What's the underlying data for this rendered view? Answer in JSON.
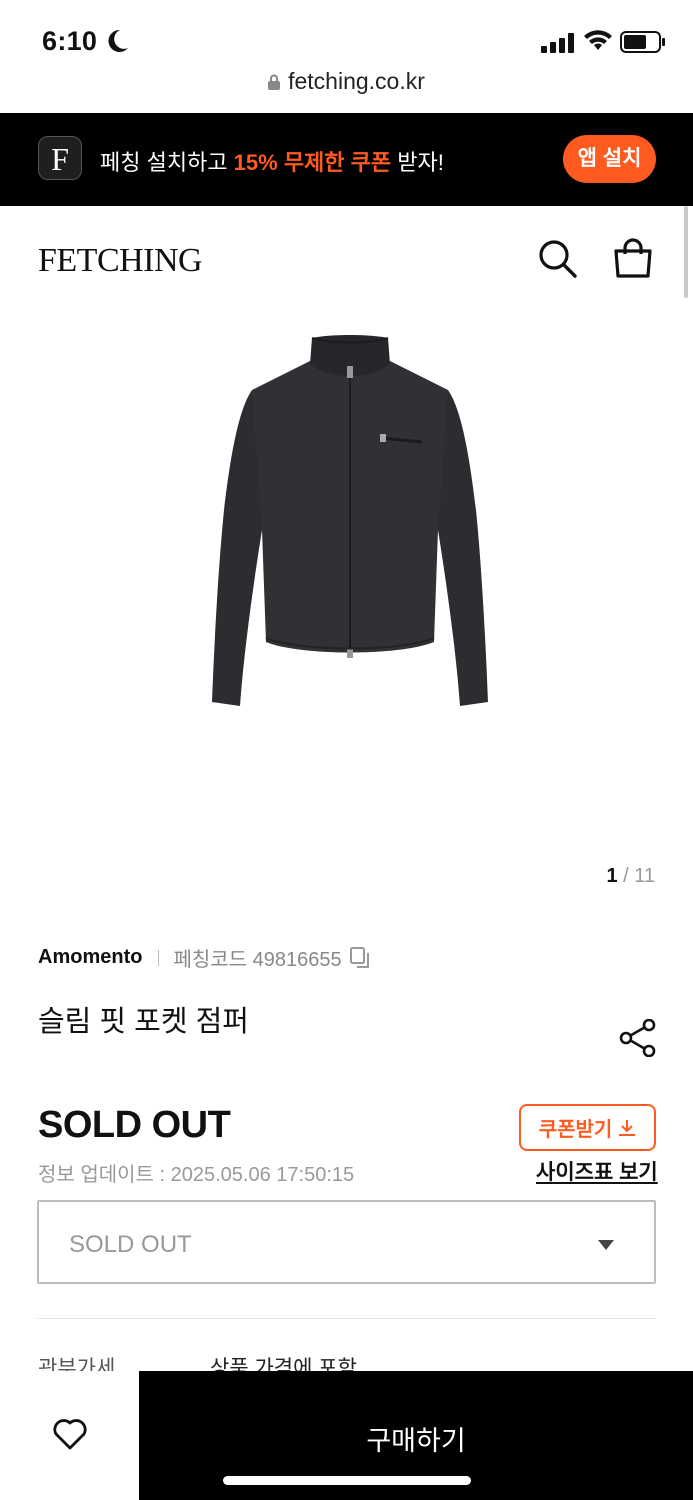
{
  "status_bar": {
    "time": "6:10"
  },
  "url_bar": {
    "url": "fetching.co.kr"
  },
  "banner": {
    "app_icon_letter": "F",
    "message_prefix": "페칭 설치하고 ",
    "message_highlight": "15% 무제한 쿠폰",
    "message_suffix": " 받자!",
    "install_label": "앱 설치",
    "accent_color": "#ff5a1f"
  },
  "header": {
    "logo": "FETCHING",
    "icons": [
      "search-icon",
      "shopping-bag-icon"
    ]
  },
  "gallery": {
    "current": "1",
    "separator": " / ",
    "total": "11"
  },
  "product": {
    "brand": "Amomento",
    "code_label": "페칭코드 49816655",
    "title": "슬림 핏 포켓 점퍼",
    "price": "SOLD OUT",
    "updated": "정보 업데이트 : 2025.05.06 17:50:15",
    "coupon_label": "쿠폰받기",
    "size_chart_label": "사이즈표 보기"
  },
  "option_select": {
    "value": "SOLD OUT"
  },
  "duty": {
    "label": "관부가세",
    "value": "상품 가격에 포함"
  },
  "bottom_bar": {
    "buy_label": "구매하기",
    "wish_icon": "heart-icon"
  }
}
